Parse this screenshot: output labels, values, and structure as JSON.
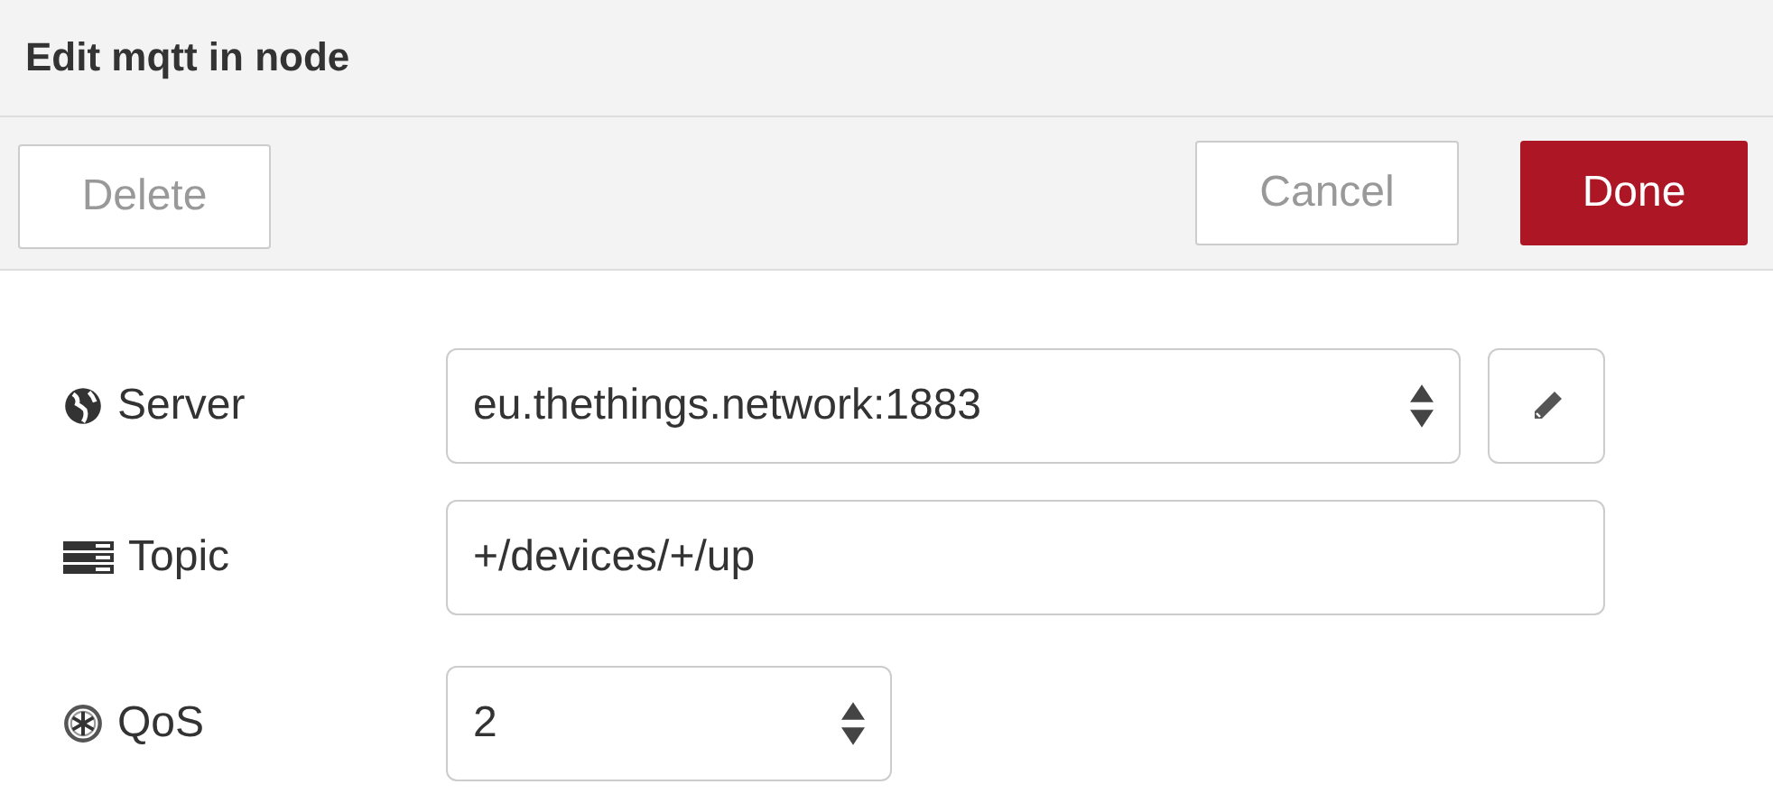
{
  "dialog": {
    "title": "Edit mqtt in node"
  },
  "toolbar": {
    "buttons": [
      {
        "label": "Delete",
        "kind": "secondary"
      },
      {
        "label": "Cancel",
        "kind": "secondary"
      },
      {
        "label": "Done",
        "kind": "primary"
      }
    ]
  },
  "fields": [
    {
      "label": "Server",
      "kind": "select",
      "value": "eu.thethings.network:1883",
      "edit_button": true
    },
    {
      "label": "Topic",
      "kind": "input",
      "value": "+/devices/+/up",
      "edit_button": false
    },
    {
      "label": "QoS",
      "kind": "select",
      "value": "2",
      "edit_button": false
    }
  ]
}
